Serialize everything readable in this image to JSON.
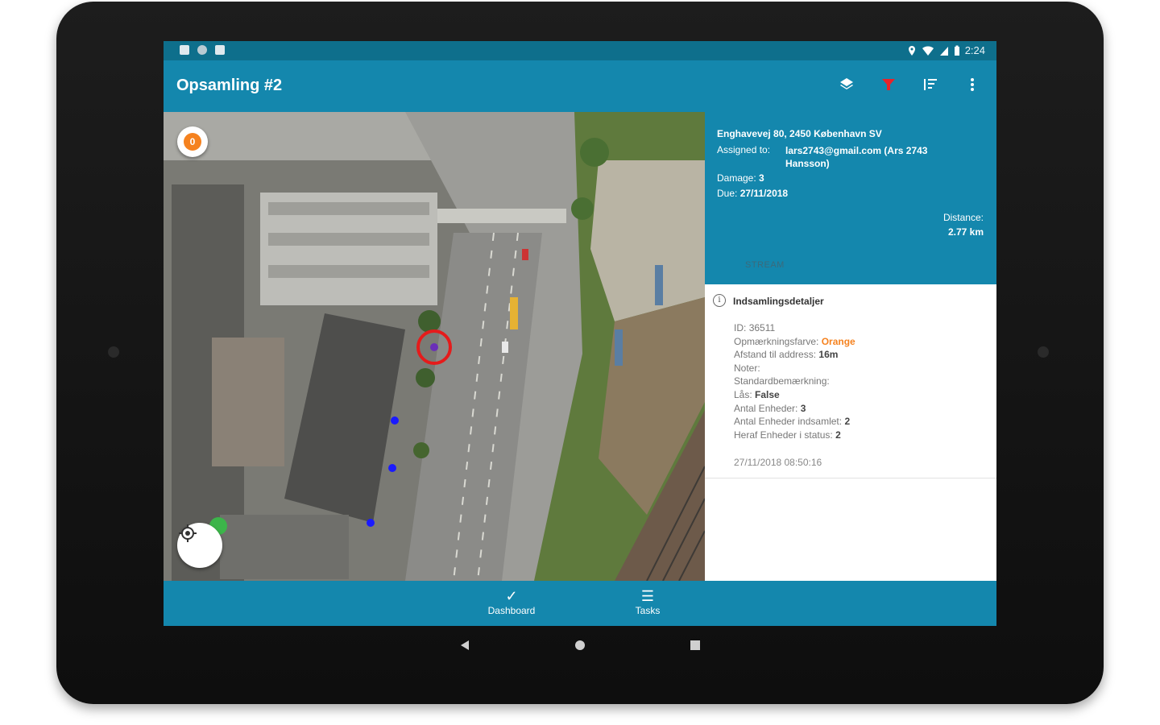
{
  "status_bar": {
    "time": "2:24"
  },
  "app_bar": {
    "title": "Opsamling #2",
    "actions": [
      "layers-icon",
      "filter-icon",
      "sort-icon",
      "more-vert-icon"
    ],
    "filter_color": "#e8232a"
  },
  "map": {
    "layer_badge_label": "0",
    "markers": {
      "selected_color": "#e51b1b",
      "point_color": "#1a1aff",
      "start_color": "#3cb54a"
    }
  },
  "panel": {
    "address": "Enghavevej 80, 2450 København SV",
    "assigned_label": "Assigned to:",
    "assigned_value": "lars2743@gmail.com (Ars 2743 Hansson)",
    "damage_label": "Damage:",
    "damage_value": "3",
    "due_label": "Due:",
    "due_value": "27/11/2018",
    "distance_label": "Distance:",
    "distance_value": "2.77 km",
    "tab_label": "STREAM",
    "details": {
      "title": "Indsamlingsdetaljer",
      "id_label": "ID:",
      "id_value": "36511",
      "color_label": "Opmærkningsfarve:",
      "color_value": "Orange",
      "distance_label": "Afstand til address:",
      "distance_value": "16m",
      "notes_label": "Noter:",
      "standard_label": "Standardbemærkning:",
      "lock_label": "Lås:",
      "lock_value": "False",
      "units_label": "Antal Enheder:",
      "units_value": "3",
      "collected_label": "Antal Enheder indsamlet:",
      "collected_value": "2",
      "status_label": "Heraf Enheder i status:",
      "status_value": "2",
      "timestamp": "27/11/2018 08:50:16"
    }
  },
  "bottom_nav": {
    "dashboard_label": "Dashboard",
    "tasks_label": "Tasks"
  },
  "colors": {
    "primary": "#1487ad",
    "status_bar": "#0e6f8c",
    "accent_orange": "#f5821f"
  }
}
